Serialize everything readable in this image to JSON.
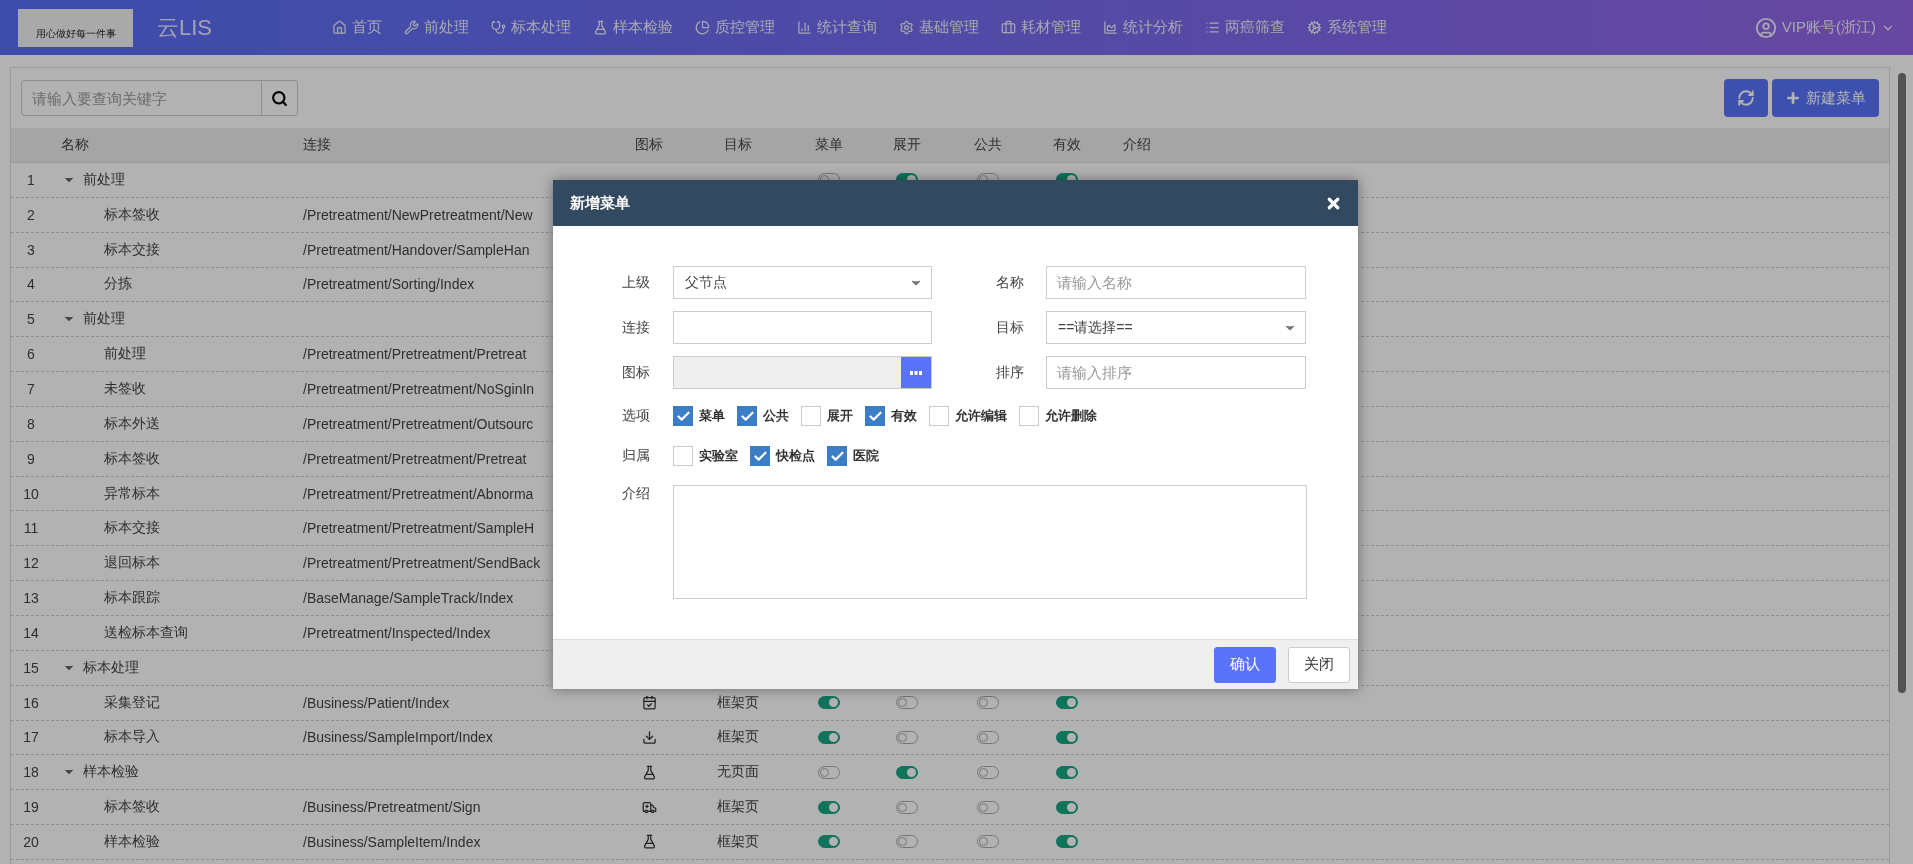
{
  "logo": {
    "slogan": "用心做好每一件事"
  },
  "brand": "云LIS",
  "nav": [
    {
      "label": "首页"
    },
    {
      "label": "前处理"
    },
    {
      "label": "标本处理"
    },
    {
      "label": "样本检验"
    },
    {
      "label": "质控管理"
    },
    {
      "label": "统计查询"
    },
    {
      "label": "基础管理"
    },
    {
      "label": "耗材管理"
    },
    {
      "label": "统计分析"
    },
    {
      "label": "两癌筛查"
    },
    {
      "label": "系统管理"
    }
  ],
  "user": "VIP账号(浙江)",
  "toolbar": {
    "search": {
      "placeholder": "请输入要查询关键字"
    },
    "new_button": "新建菜单"
  },
  "table": {
    "columns": [
      "名称",
      "连接",
      "图标",
      "目标",
      "菜单",
      "展开",
      "公共",
      "有效",
      "介绍"
    ],
    "rows": [
      {
        "no": "1",
        "name": "前处理",
        "expanded": true,
        "menu": false,
        "expand": true,
        "public": false,
        "valid": true,
        "children": [
          {
            "no": "2",
            "name": "标本签收",
            "link": "/Pretreatment/NewPretreatment/New"
          },
          {
            "no": "3",
            "name": "标本交接",
            "link": "/Pretreatment/Handover/SampleHan"
          },
          {
            "no": "4",
            "name": "分拣",
            "link": "/Pretreatment/Sorting/Index"
          }
        ]
      },
      {
        "no": "5",
        "name": "前处理",
        "expanded": true,
        "children": [
          {
            "no": "6",
            "name": "前处理",
            "link": "/Pretreatment/Pretreatment/Pretreat"
          },
          {
            "no": "7",
            "name": "未签收",
            "link": "/Pretreatment/Pretreatment/NoSginIn"
          },
          {
            "no": "8",
            "name": "标本外送",
            "link": "/Pretreatment/Pretreatment/Outsourc"
          },
          {
            "no": "9",
            "name": "标本签收",
            "link": "/Pretreatment/Pretreatment/Pretreat"
          },
          {
            "no": "10",
            "name": "异常标本",
            "link": "/Pretreatment/Pretreatment/Abnorma"
          },
          {
            "no": "11",
            "name": "标本交接",
            "link": "/Pretreatment/Pretreatment/SampleH"
          },
          {
            "no": "12",
            "name": "退回标本",
            "link": "/Pretreatment/Pretreatment/SendBack"
          },
          {
            "no": "13",
            "name": "标本跟踪",
            "link": "/BaseManage/SampleTrack/Index"
          },
          {
            "no": "14",
            "name": "送检标本查询",
            "link": "/Pretreatment/Inspected/Index"
          }
        ]
      },
      {
        "no": "15",
        "name": "标本处理",
        "expanded": true,
        "children": [
          {
            "no": "16",
            "name": "采集登记",
            "link": "/Business/Patient/Index",
            "target": "框架页",
            "menu": true,
            "expand": false,
            "public": false,
            "valid": true
          },
          {
            "no": "17",
            "name": "标本导入",
            "link": "/Business/SampleImport/Index",
            "target": "框架页",
            "menu": true,
            "expand": false,
            "public": false,
            "valid": true
          }
        ]
      },
      {
        "no": "18",
        "name": "样本检验",
        "expanded": true,
        "target": "无页面",
        "menu": false,
        "expand": true,
        "public": false,
        "valid": true,
        "children": [
          {
            "no": "19",
            "name": "标本签收",
            "link": "/Business/Pretreatment/Sign",
            "target": "框架页",
            "menu": true,
            "expand": false,
            "public": false,
            "valid": true
          },
          {
            "no": "20",
            "name": "样本检验",
            "link": "/Business/SampleItem/Index",
            "target": "框架页",
            "menu": true,
            "expand": false,
            "public": false,
            "valid": true
          }
        ]
      }
    ]
  },
  "dialog": {
    "title": "新增菜单",
    "fields": [
      {
        "label": "上级",
        "kind": "select",
        "value": "父节点"
      },
      {
        "label": "名称",
        "kind": "text",
        "placeholder": "请输入名称"
      },
      {
        "label": "连接",
        "kind": "text"
      },
      {
        "label": "目标",
        "kind": "select",
        "value": "==请选择=="
      },
      {
        "label": "图标",
        "kind": "picker",
        "disabled": true
      },
      {
        "label": "排序",
        "kind": "text",
        "placeholder": "请输入排序"
      }
    ],
    "options": {
      "label": "选项",
      "items": [
        {
          "label": "菜单",
          "checked": true
        },
        {
          "label": "公共",
          "checked": true
        },
        {
          "label": "展开",
          "checked": false
        },
        {
          "label": "有效",
          "checked": true
        },
        {
          "label": "允许编辑",
          "checked": false
        },
        {
          "label": "允许删除",
          "checked": false
        }
      ]
    },
    "belongs": {
      "label": "归属",
      "items": [
        {
          "label": "实验室",
          "checked": false
        },
        {
          "label": "快检点",
          "checked": true
        },
        {
          "label": "医院",
          "checked": true
        }
      ]
    },
    "intro": {
      "label": "介绍"
    },
    "buttons": [
      {
        "label": "确认",
        "kind": "primary"
      },
      {
        "label": "关闭",
        "kind": "default"
      }
    ]
  }
}
